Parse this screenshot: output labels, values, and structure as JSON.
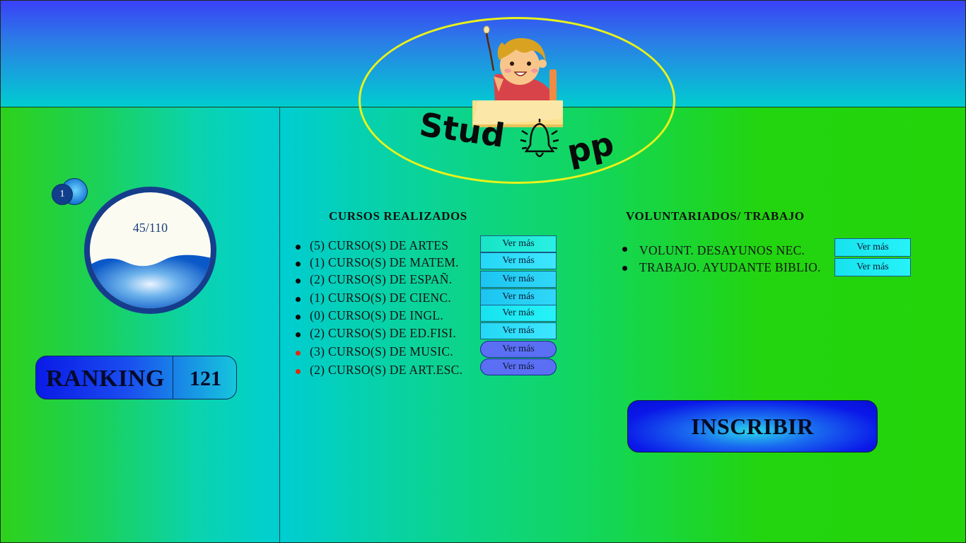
{
  "app": {
    "logo_text": "StudApp"
  },
  "profile": {
    "notification_count": "1",
    "progress_text": "45/110",
    "progress_fraction": 0.41,
    "ranking_label": "RANKING",
    "ranking_value": "121"
  },
  "courses": {
    "heading": "CURSOS REALIZADOS",
    "items": [
      {
        "text": "(5) CURSO(S) DE ARTES",
        "bullet": "black",
        "button": "Ver más"
      },
      {
        "text": "(1) CURSO(S) DE MATEM.",
        "bullet": "black",
        "button": "Ver más"
      },
      {
        "text": "(2) CURSO(S) DE ESPAÑ.",
        "bullet": "black",
        "button": "Ver más"
      },
      {
        "text": "(1) CURSO(S) DE CIENC.",
        "bullet": "black",
        "button": "Ver más"
      },
      {
        "text": "(0) CURSO(S) DE INGL.",
        "bullet": "black",
        "button": "Ver más"
      },
      {
        "text": "(2) CURSO(S) DE ED.FISI.",
        "bullet": "black",
        "button": "Ver más"
      },
      {
        "text": "(3) CURSO(S) DE MUSIC.",
        "bullet": "red",
        "button": "Ver más"
      },
      {
        "text": "(2) CURSO(S) DE ART.ESC.",
        "bullet": "red",
        "button": "Ver más"
      }
    ]
  },
  "volunteering": {
    "heading": "VOLUNTARIADOS/ TRABAJO",
    "items": [
      {
        "text": "VOLUNT. DESAYUNOS NEC.",
        "button": "Ver más"
      },
      {
        "text": "TRABAJO. AYUDANTE BIBLIO.",
        "button": "Ver más"
      }
    ]
  },
  "actions": {
    "enroll_label": "INSCRIBIR"
  },
  "colors": {
    "background_green": "#22d40e",
    "header_blue": "#3a40f7",
    "teal": "#00cdd2",
    "ellipse_yellow": "#e9f21a",
    "bullet_red": "#e02b10"
  },
  "icons": {
    "logo": "student-at-desk-icon",
    "bell": "bell-icon"
  }
}
